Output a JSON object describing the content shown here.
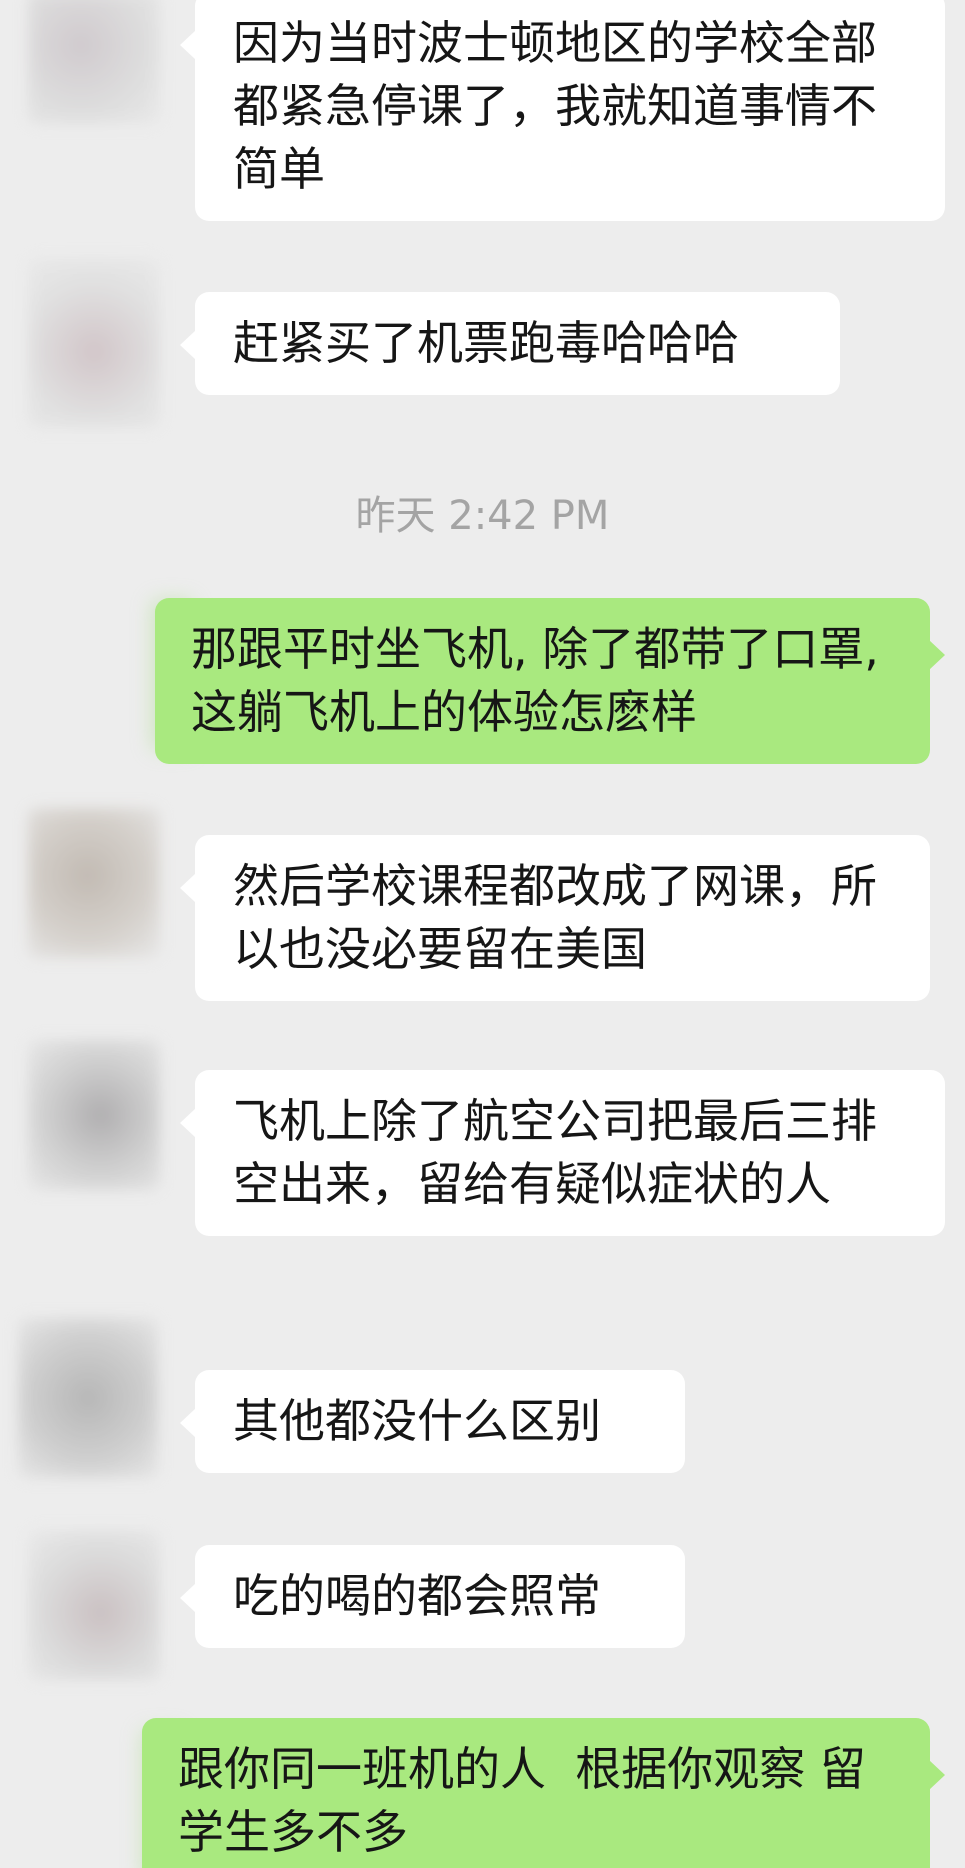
{
  "messages": [
    {
      "side": "left",
      "text": "因为当时波士顿地区的学校全部都紧急停课了，我就知道事情不简单"
    },
    {
      "side": "left",
      "text": "赶紧买了机票跑毒哈哈哈"
    },
    {
      "side": "right",
      "text": "那跟平时坐飞机, 除了都带了口罩, 这躺飞机上的体验怎麽样"
    },
    {
      "side": "left",
      "text": "然后学校课程都改成了网课，所以也没必要留在美国"
    },
    {
      "side": "left",
      "text": "飞机上除了航空公司把最后三排空出来，留给有疑似症状的人"
    },
    {
      "side": "left",
      "text": "其他都没什么区别"
    },
    {
      "side": "left",
      "text": "吃的喝的都会照常"
    },
    {
      "side": "right",
      "text": "跟你同一班机的人  根据你观察 留学生多不多"
    }
  ],
  "timestamp": "昨天 2:42 PM",
  "colors": {
    "background": "#ededed",
    "incoming_bubble": "#ffffff",
    "outgoing_bubble": "#a9e97f",
    "timestamp_text": "#a4a4a4"
  }
}
